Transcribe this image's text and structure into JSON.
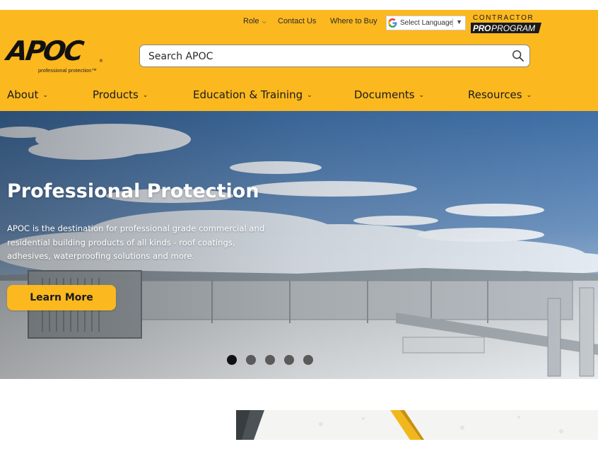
{
  "utility_nav": {
    "links": [
      {
        "label": "Role",
        "has_dropdown": true
      },
      {
        "label": "Contact Us",
        "has_dropdown": false
      },
      {
        "label": "Where to Buy",
        "has_dropdown": false
      }
    ],
    "language": {
      "label": "Select Language",
      "icon": "google-g-icon"
    },
    "pro_program": {
      "top": "CONTRACTOR",
      "bold": "PRO",
      "rest": "PROGRAM"
    }
  },
  "logo": {
    "mark": "APOC",
    "registered": "®",
    "tagline": "professional protection™"
  },
  "search": {
    "placeholder": "Search APOC",
    "value": "",
    "icon": "search-icon"
  },
  "main_nav": {
    "items": [
      {
        "label": "About",
        "chevron": "⌄"
      },
      {
        "label": "Products",
        "chevron": "⌄"
      },
      {
        "label": "Education & Training",
        "chevron": "⌄"
      },
      {
        "label": "Documents",
        "chevron": "⌄"
      },
      {
        "label": "Resources",
        "chevron": "⌄"
      }
    ]
  },
  "hero": {
    "title": "Professional Protection",
    "body": "APOC is the destination for professional grade commercial and residential building products of all kinds - roof coatings, adhesives, waterproofing solutions and more.",
    "cta_label": "Learn More",
    "slides_total": 5,
    "active_slide": 1
  },
  "colors": {
    "brand_yellow": "#fbb81f",
    "text_dark": "#1b1b1b",
    "dot_active": "#111111",
    "dot_inactive": "#5a5a5a"
  }
}
